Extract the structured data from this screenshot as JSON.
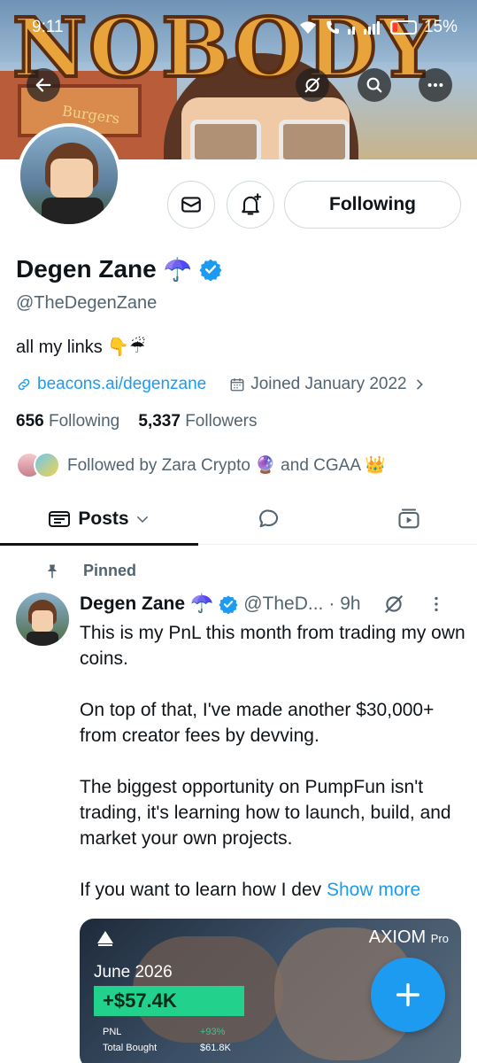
{
  "status_bar": {
    "time": "9:11",
    "battery": "15%"
  },
  "banner": {
    "title": "NOBODY",
    "sign_text": "Burgers"
  },
  "profile": {
    "name": "Degen Zane",
    "name_emoji": "☂️",
    "handle": "@TheDegenZane",
    "bio": "all my links 👇☔",
    "link": "beacons.ai/degenzane",
    "joined": "Joined January 2022",
    "following_count": "656",
    "following_label": "Following",
    "followers_count": "5,337",
    "followers_label": "Followers",
    "followed_by": "Followed by Zara Crypto 🔮 and CGAA 👑",
    "follow_button": "Following"
  },
  "tabs": {
    "posts": "Posts"
  },
  "post": {
    "pinned_label": "Pinned",
    "author_name": "Degen Zane",
    "author_emoji": "☂️",
    "author_handle": "@TheD...",
    "time": "· 9h",
    "paragraphs": [
      "This is my PnL this month from trading my own coins.",
      "On top of that, I've made another $30,000+ from creator fees by devving.",
      "The biggest opportunity on PumpFun isn't trading,  it's learning how to launch, build, and market your own projects."
    ],
    "last_paragraph": "If you want to learn how I dev ",
    "show_more": "Show more"
  },
  "media": {
    "brand": "AXIOM",
    "brand_suffix": "Pro",
    "month": "June 2026",
    "pnl": "+$57.4K",
    "row1_label": "PNL",
    "row1_value": "+93%",
    "row2_label": "Total Bought",
    "row2_value": "$61.8K"
  },
  "colors": {
    "accent": "#1d9bf0",
    "text": "#0f1419",
    "muted": "#536471",
    "pnl_green": "#22d18b"
  }
}
